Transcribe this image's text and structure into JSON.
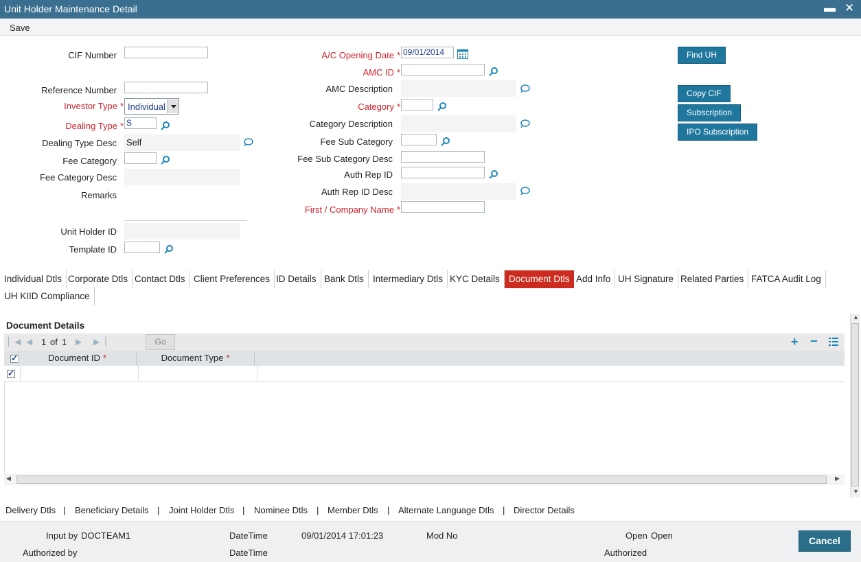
{
  "window": {
    "title": "Unit Holder Maintenance Detail",
    "minimize": "▬",
    "close": "✕"
  },
  "toolbar": {
    "save_label": "Save"
  },
  "left_fields": {
    "cif_number": {
      "label": "CIF Number",
      "value": ""
    },
    "reference_number": {
      "label": "Reference Number",
      "value": ""
    },
    "investor_type": {
      "label": "Investor Type",
      "value": "Individual"
    },
    "dealing_type": {
      "label": "Dealing Type",
      "value": "S"
    },
    "dealing_type_desc": {
      "label": "Dealing Type Desc",
      "value": "Self"
    },
    "fee_category": {
      "label": "Fee Category",
      "value": ""
    },
    "fee_category_desc": {
      "label": "Fee Category Desc",
      "value": ""
    },
    "remarks": {
      "label": "Remarks",
      "value": ""
    },
    "unit_holder_id": {
      "label": "Unit Holder ID",
      "value": ""
    },
    "template_id": {
      "label": "Template ID",
      "value": ""
    }
  },
  "middle_fields": {
    "ac_opening_date": {
      "label": "A/C Opening Date",
      "value": "09/01/2014"
    },
    "amc_id": {
      "label": "AMC ID",
      "value": ""
    },
    "amc_description": {
      "label": "AMC Description",
      "value": ""
    },
    "category": {
      "label": "Category",
      "value": ""
    },
    "category_description": {
      "label": "Category Description",
      "value": ""
    },
    "fee_sub_category": {
      "label": "Fee Sub Category",
      "value": ""
    },
    "fee_sub_category_desc": {
      "label": "Fee Sub Category Desc",
      "value": ""
    },
    "auth_rep_id": {
      "label": "Auth Rep ID",
      "value": ""
    },
    "auth_rep_id_desc": {
      "label": "Auth Rep ID Desc",
      "value": ""
    },
    "first_company_name": {
      "label": "First / Company Name",
      "value": ""
    }
  },
  "required_mark": "*",
  "right_buttons": {
    "find_uh": "Find UH",
    "copy_cif": "Copy CIF",
    "subscription": "Subscription",
    "ipo_subscription": "IPO Subscription"
  },
  "tabs": [
    "Individual Dtls",
    "Corporate Dtls",
    "Contact Dtls",
    "Client Preferences",
    "ID Details",
    "Bank Dtls",
    "Intermediary Dtls",
    "KYC Details",
    "Document Dtls",
    "Add Info",
    "UH Signature",
    "Related Parties",
    "FATCA Audit Log",
    "UH KIID Compliance"
  ],
  "active_tab": "Document Dtls",
  "document_details": {
    "title": "Document Details",
    "pager": {
      "current": "1",
      "of": "of",
      "total": "1",
      "go": "Go"
    },
    "columns": [
      "Document ID",
      "Document Type"
    ],
    "rows": [
      {
        "checked": true,
        "document_id": "",
        "document_type": ""
      }
    ]
  },
  "bottom_links": [
    "Delivery Dtls",
    "Beneficiary Details",
    "Joint Holder Dtls",
    "Nominee Dtls",
    "Member Dtls",
    "Alternate Language Dtls",
    "Director Details"
  ],
  "link_separator": "|",
  "footer": {
    "input_by_label": "Input by",
    "input_by_value": "DOCTEAM1",
    "datetime_label": "DateTime",
    "datetime_value": "09/01/2014 17:01:23",
    "mod_no_label": "Mod No",
    "open_label": "Open",
    "open_value": "Open",
    "authorized_by_label": "Authorized by",
    "datetime2_label": "DateTime",
    "authorized_label": "Authorized",
    "cancel": "Cancel"
  },
  "colors": {
    "titlebar": "#3a6f8f",
    "button": "#20779e",
    "active_tab": "#cc2b20",
    "required": "#d0202a",
    "icon": "#1a86b8"
  }
}
